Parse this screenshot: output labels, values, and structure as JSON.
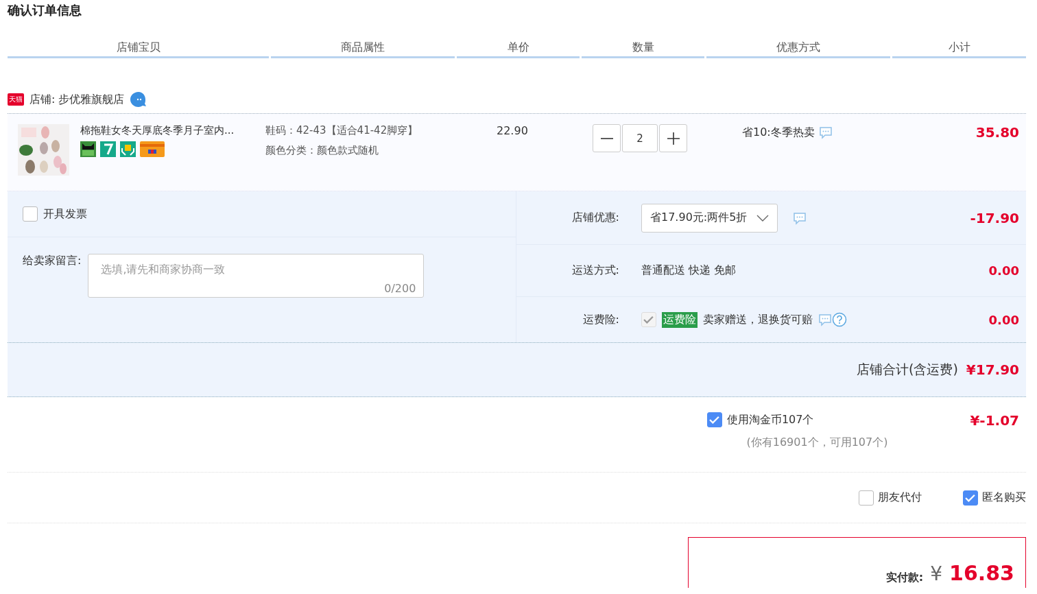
{
  "title": "确认订单信息",
  "columns": [
    "店铺宝贝",
    "商品属性",
    "单价",
    "数量",
    "优惠方式",
    "小计"
  ],
  "shop": {
    "badge": "天猫",
    "label": "店铺: 步优雅旗舰店"
  },
  "item": {
    "title": "棉拖鞋女冬天厚底冬季月子室内...",
    "props": [
      "鞋码：42-43【适合41-42脚穿】",
      "颜色分类：颜色款式随机"
    ],
    "price": "22.90",
    "quantity": "2",
    "promo": "省10:冬季热卖",
    "subtotal": "35.80"
  },
  "invoice": {
    "label": "开具发票",
    "checked": false
  },
  "message": {
    "label": "给卖家留言:",
    "placeholder": "选填,请先和商家协商一致",
    "counter": "0/200"
  },
  "fees": [
    {
      "kind": "select",
      "label": "店铺优惠:",
      "value": "省17.90元:两件5折",
      "amount": "-17.90"
    },
    {
      "kind": "text",
      "label": "运送方式:",
      "value": "普通配送 快递 免邮",
      "amount": "0.00"
    },
    {
      "kind": "insurance",
      "label": "运费险:",
      "checked": true,
      "tag": "运费险",
      "value": "卖家赠送，退换货可赔",
      "amount": "0.00"
    }
  ],
  "shop_total": {
    "label": "店铺合计(含运费)",
    "amount": "¥17.90"
  },
  "coins": {
    "label": "使用淘金币107个",
    "checked": true,
    "note": "(你有16901个，可用107个)",
    "amount": "¥-1.07"
  },
  "options": [
    {
      "label": "朋友代付",
      "checked": false
    },
    {
      "label": "匿名购买",
      "checked": true
    }
  ],
  "payment": {
    "label": "实付款:",
    "currency": "¥",
    "amount": "16.83"
  }
}
